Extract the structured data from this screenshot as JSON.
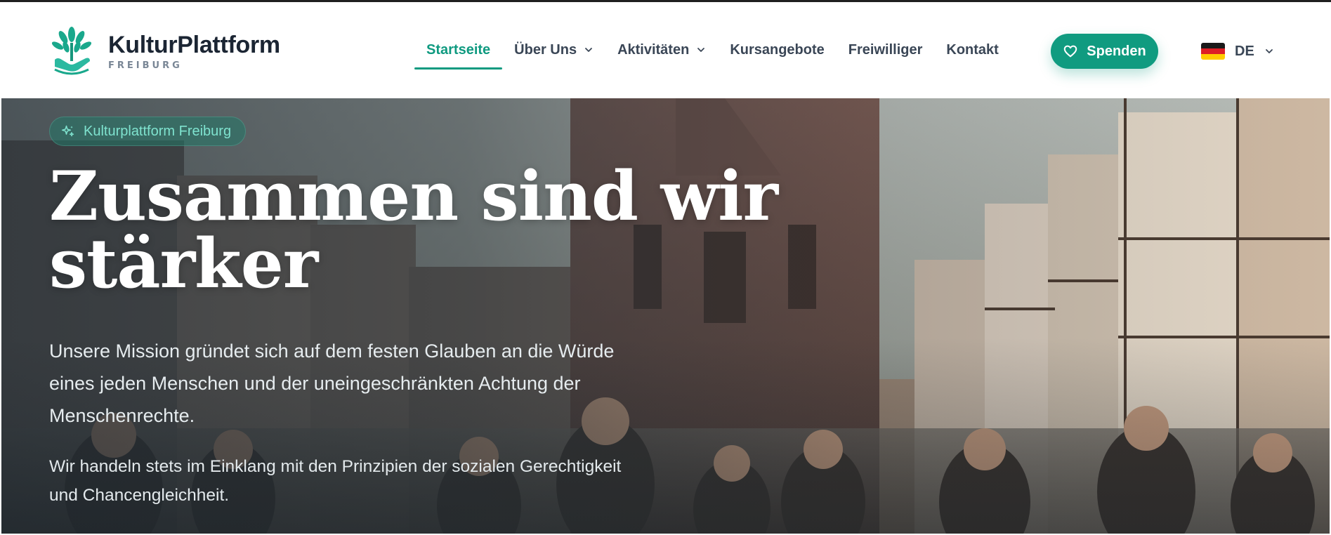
{
  "brand": {
    "name": "KulturPlattform",
    "subtitle": "FREIBURG",
    "logo_icon": "tree-hand-icon",
    "accent_color": "#0f9a80"
  },
  "nav": {
    "items": [
      {
        "label": "Startseite",
        "active": true,
        "has_dropdown": false
      },
      {
        "label": "Über Uns",
        "active": false,
        "has_dropdown": true
      },
      {
        "label": "Aktivitäten",
        "active": false,
        "has_dropdown": true
      },
      {
        "label": "Kursangebote",
        "active": false,
        "has_dropdown": false
      },
      {
        "label": "Freiwilliger",
        "active": false,
        "has_dropdown": false
      },
      {
        "label": "Kontakt",
        "active": false,
        "has_dropdown": false
      }
    ],
    "donate_label": "Spenden",
    "donate_icon": "heart-icon"
  },
  "language": {
    "code": "DE",
    "flag": "germany-flag-icon"
  },
  "hero": {
    "badge": "Kulturplattform Freiburg",
    "badge_icon": "sparkles-icon",
    "title_line1": "Zusammen sind wir",
    "title_line2": "stärker",
    "paragraph1": "Unsere Mission gründet sich auf dem festen Glauben an die Würde eines jeden Menschen und der uneingeschränkten Achtung der Menschenrechte.",
    "paragraph2": "Wir handeln stets im Einklang mit den Prinzipien der sozialen Gerechtigkeit und Chancengleichheit."
  }
}
